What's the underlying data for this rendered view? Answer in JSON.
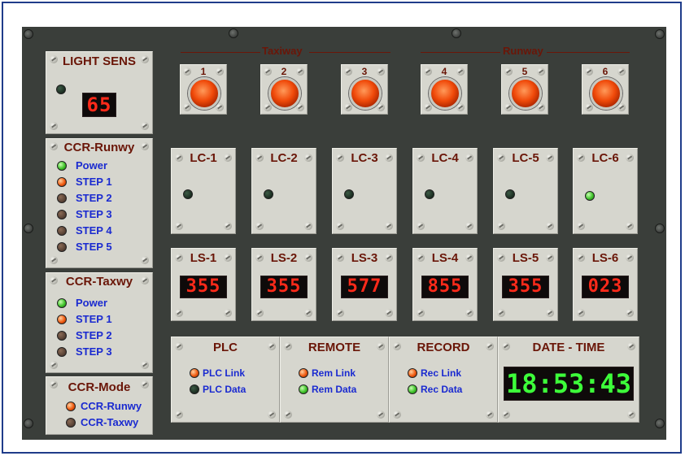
{
  "light_sens": {
    "title": "LIGHT SENS",
    "value": "65"
  },
  "ccr_runway": {
    "title": "CCR-Runwy",
    "items": [
      "Power",
      "STEP 1",
      "STEP 2",
      "STEP 3",
      "STEP 4",
      "STEP 5"
    ]
  },
  "ccr_taxiway": {
    "title": "CCR-Taxwy",
    "items": [
      "Power",
      "STEP 1",
      "STEP 2",
      "STEP 3"
    ]
  },
  "ccr_mode": {
    "title": "CCR-Mode",
    "items": [
      "CCR-Runwy",
      "CCR-Taxwy"
    ]
  },
  "section_labels": {
    "taxiway": "Taxiway",
    "runway": "Runway"
  },
  "lamps": [
    "1",
    "2",
    "3",
    "4",
    "5",
    "6"
  ],
  "lc_panels": [
    "LC-1",
    "LC-2",
    "LC-3",
    "LC-4",
    "LC-5",
    "LC-6"
  ],
  "ls_panels": [
    {
      "label": "LS-1",
      "value": "355"
    },
    {
      "label": "LS-2",
      "value": "355"
    },
    {
      "label": "LS-3",
      "value": "577"
    },
    {
      "label": "LS-4",
      "value": "855"
    },
    {
      "label": "LS-5",
      "value": "355"
    },
    {
      "label": "LS-6",
      "value": "023"
    }
  ],
  "plc": {
    "title": "PLC",
    "items": [
      "PLC Link",
      "PLC Data"
    ]
  },
  "remote": {
    "title": "REMOTE",
    "items": [
      "Rem Link",
      "Rem Data"
    ]
  },
  "record": {
    "title": "RECORD",
    "items": [
      "Rec Link",
      "Rec Data"
    ]
  },
  "date_time": {
    "title": "DATE - TIME",
    "value": "18:53:43"
  },
  "colors": {
    "led_green": "#3fc32a",
    "led_red": "#f05a10",
    "label_blue": "#1a2ad0",
    "title_brown": "#6a1608",
    "segment_red": "#ff2a1a",
    "segment_green": "#3dff3a"
  }
}
